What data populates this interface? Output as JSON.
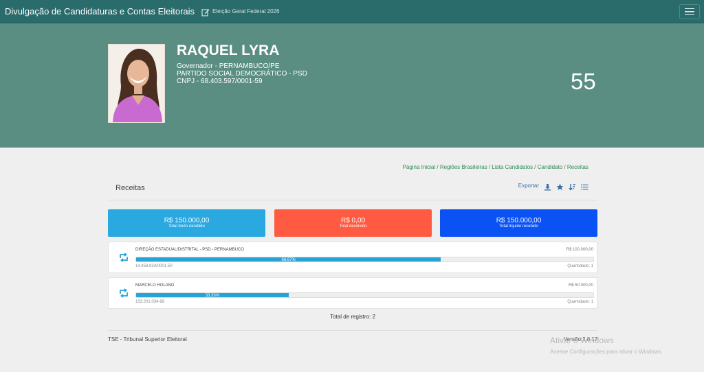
{
  "header": {
    "app_title": "Divulgação de Candidaturas e Contas Eleitorais",
    "election": "Eleição Geral Federal 2026",
    "edit_icon": "edit-icon",
    "menu_icon": "hamburger-menu-icon"
  },
  "candidate": {
    "name": "RAQUEL LYRA",
    "office": "Governador - PERNAMBUCO/PE",
    "party": "PARTIDO SOCIAL DEMOCRÁTICO - PSD",
    "cnpj": "CNPJ - 68.403.597/0001-59",
    "number": "55"
  },
  "breadcrumb": {
    "items": [
      "Página Inicial",
      "Regiões Brasileiras",
      "Lista Candidatos",
      "Candidato"
    ],
    "current": "Receitas",
    "separator": "/"
  },
  "section": {
    "title": "Receitas",
    "export_label": "Exportar",
    "icons": [
      "download-icon",
      "star-icon",
      "sort-icon",
      "list-icon"
    ]
  },
  "stats": [
    {
      "value": "R$ 150.000,00",
      "label": "Total bruto recebido",
      "color": "#2aa8e0"
    },
    {
      "value": "R$ 0,00",
      "label": "Total devolvido",
      "color": "#ff5b43"
    },
    {
      "value": "R$ 150.000,00",
      "label": "Total líquido recebido",
      "color": "#0a52f3"
    }
  ],
  "receitas": [
    {
      "donor": "DIREÇÃO ESTADUAL/DISTRITAL - PSD - PERNAMBUCO",
      "amount": "R$ 100.000,00",
      "percent_label": "66.67%",
      "percent": 66.67,
      "document": "14.458.834/0001-50",
      "quantity": "Quantidade: 1"
    },
    {
      "donor": "MARCELO HOLAND",
      "amount": "R$ 50.000,00",
      "percent_label": "33.33%",
      "percent": 33.33,
      "document": "153.201.034-68",
      "quantity": "Quantidade: 1"
    }
  ],
  "total_records": "Total de registro: 2",
  "footer": {
    "left": "TSE - Tribunal Superior Eleitoral",
    "version": "Versão 2.8.17"
  },
  "watermark": {
    "line1": "Ativar o Windows",
    "line2": "Acesse Configurações para ativar o Windows."
  },
  "colors": {
    "topbar": "#2a6b6b",
    "hero": "#5b8e82",
    "accent_link": "#2e8b57",
    "progress": "#27a3d8"
  }
}
